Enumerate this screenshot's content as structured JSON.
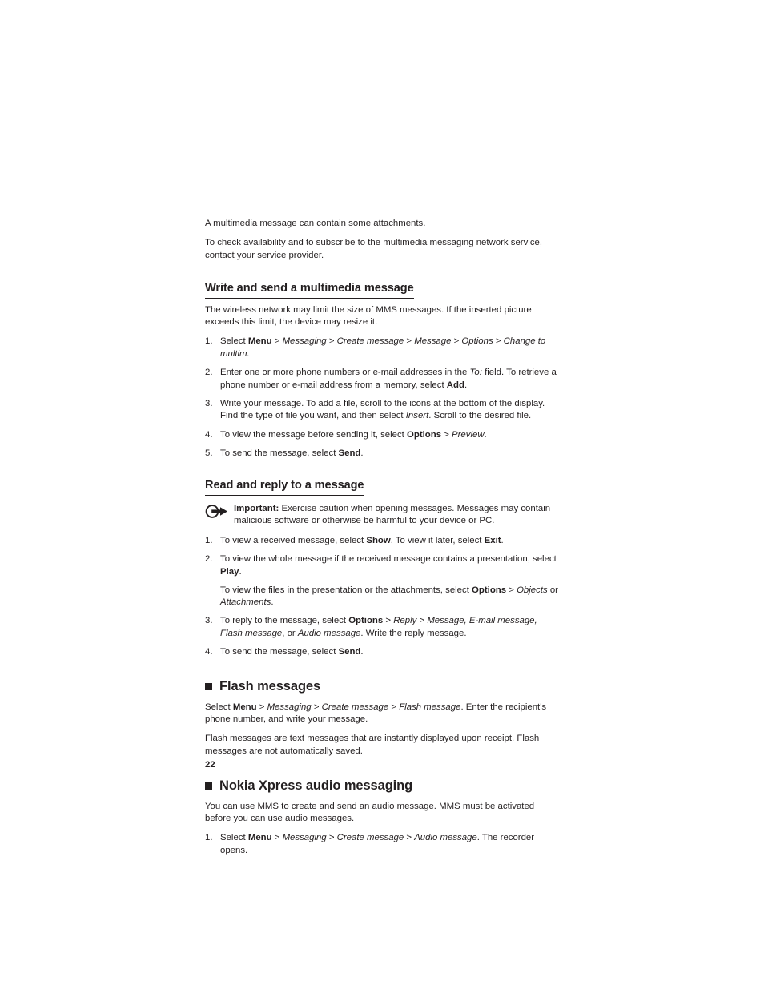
{
  "document": {
    "page_number": "22",
    "text_color": "#231f20",
    "background_color": "#ffffff"
  },
  "intro": {
    "para1": "A multimedia message can contain some attachments.",
    "para2": "To check availability and to subscribe to the multimedia messaging network service, contact your service provider."
  },
  "section_write_send": {
    "heading": "Write and send a multimedia message",
    "intro": "The wireless network may limit the size of MMS messages. If the inserted picture exceeds this limit, the device may resize it.",
    "steps": [
      {
        "num": "1.",
        "parts": [
          {
            "text": "Select ",
            "style": "normal"
          },
          {
            "text": "Menu",
            "style": "bold"
          },
          {
            "text": " > ",
            "style": "normal"
          },
          {
            "text": "Messaging",
            "style": "italic"
          },
          {
            "text": " > ",
            "style": "normal"
          },
          {
            "text": "Create message",
            "style": "italic"
          },
          {
            "text": " > ",
            "style": "normal"
          },
          {
            "text": "Message",
            "style": "italic"
          },
          {
            "text": " > ",
            "style": "normal"
          },
          {
            "text": "Options",
            "style": "italic"
          },
          {
            "text": " > ",
            "style": "normal"
          },
          {
            "text": "Change to multim.",
            "style": "italic"
          }
        ]
      },
      {
        "num": "2.",
        "parts": [
          {
            "text": "Enter one or more phone numbers or e-mail addresses in the ",
            "style": "normal"
          },
          {
            "text": "To:",
            "style": "italic"
          },
          {
            "text": " field. To retrieve a phone number or e-mail address from a memory, select ",
            "style": "normal"
          },
          {
            "text": "Add",
            "style": "bold"
          },
          {
            "text": ".",
            "style": "normal"
          }
        ]
      },
      {
        "num": "3.",
        "parts": [
          {
            "text": "Write your message. To add a file, scroll to the icons at the bottom of the display.",
            "style": "normal"
          },
          {
            "text": "BREAK",
            "style": "break"
          },
          {
            "text": "Find the type of file you want, and then select ",
            "style": "normal"
          },
          {
            "text": "Insert",
            "style": "italic"
          },
          {
            "text": ". Scroll to the desired file.",
            "style": "normal"
          }
        ]
      },
      {
        "num": "4.",
        "parts": [
          {
            "text": "To view the message before sending it, select ",
            "style": "normal"
          },
          {
            "text": "Options",
            "style": "bold"
          },
          {
            "text": " > ",
            "style": "normal"
          },
          {
            "text": "Preview",
            "style": "italic"
          },
          {
            "text": ".",
            "style": "normal"
          }
        ]
      },
      {
        "num": "5.",
        "parts": [
          {
            "text": "To send the message, select ",
            "style": "normal"
          },
          {
            "text": "Send",
            "style": "bold"
          },
          {
            "text": ".",
            "style": "normal"
          }
        ]
      }
    ]
  },
  "section_read_reply": {
    "heading": "Read and reply to a message",
    "important": {
      "icon": "important-pointer-icon",
      "label": "Important:",
      "text": " Exercise caution when opening messages. Messages may contain malicious software or otherwise be harmful to your device or PC."
    },
    "steps": [
      {
        "num": "1.",
        "parts": [
          {
            "text": "To view a received message, select ",
            "style": "normal"
          },
          {
            "text": "Show",
            "style": "bold"
          },
          {
            "text": ". To view it later, select ",
            "style": "normal"
          },
          {
            "text": "Exit",
            "style": "bold"
          },
          {
            "text": ".",
            "style": "normal"
          }
        ]
      },
      {
        "num": "2.",
        "parts": [
          {
            "text": "To view the whole message if the received message contains a presentation, select ",
            "style": "normal"
          },
          {
            "text": "Play",
            "style": "bold"
          },
          {
            "text": ".",
            "style": "normal"
          },
          {
            "text": "PARA",
            "style": "para"
          },
          {
            "text": "To view the files in the presentation or the attachments, select ",
            "style": "normal"
          },
          {
            "text": "Options",
            "style": "bold"
          },
          {
            "text": " > ",
            "style": "normal"
          },
          {
            "text": "Objects",
            "style": "italic"
          },
          {
            "text": " or ",
            "style": "normal"
          },
          {
            "text": "Attachments",
            "style": "italic"
          },
          {
            "text": ".",
            "style": "normal"
          }
        ]
      },
      {
        "num": "3.",
        "parts": [
          {
            "text": "To reply to the message, select ",
            "style": "normal"
          },
          {
            "text": "Options",
            "style": "bold"
          },
          {
            "text": " > ",
            "style": "normal"
          },
          {
            "text": "Reply",
            "style": "italic"
          },
          {
            "text": " > ",
            "style": "normal"
          },
          {
            "text": "Message, E-mail message, Flash message",
            "style": "italic"
          },
          {
            "text": ", or ",
            "style": "normal"
          },
          {
            "text": "Audio message",
            "style": "italic"
          },
          {
            "text": ". Write the reply message.",
            "style": "normal"
          }
        ]
      },
      {
        "num": "4.",
        "parts": [
          {
            "text": "To send the message, select ",
            "style": "normal"
          },
          {
            "text": "Send",
            "style": "bold"
          },
          {
            "text": ".",
            "style": "normal"
          }
        ]
      }
    ]
  },
  "section_flash": {
    "bullet": "square-bullet-icon",
    "heading": "Flash messages",
    "para1_parts": [
      {
        "text": "Select ",
        "style": "normal"
      },
      {
        "text": "Menu",
        "style": "bold"
      },
      {
        "text": " > ",
        "style": "normal"
      },
      {
        "text": "Messaging",
        "style": "italic"
      },
      {
        "text": " > ",
        "style": "normal"
      },
      {
        "text": "Create message",
        "style": "italic"
      },
      {
        "text": " > ",
        "style": "normal"
      },
      {
        "text": "Flash message",
        "style": "italic"
      },
      {
        "text": ". Enter the recipient's phone number, and write your message.",
        "style": "normal"
      }
    ],
    "para2": "Flash messages are text messages that are instantly displayed upon receipt. Flash messages are not automatically saved."
  },
  "section_xpress": {
    "bullet": "square-bullet-icon",
    "heading": "Nokia Xpress audio messaging",
    "para1": "You can use MMS to create and send an audio message. MMS must be activated before you can use audio messages.",
    "steps": [
      {
        "num": "1.",
        "parts": [
          {
            "text": "Select ",
            "style": "normal"
          },
          {
            "text": "Menu",
            "style": "bold"
          },
          {
            "text": " > ",
            "style": "normal"
          },
          {
            "text": "Messaging",
            "style": "italic"
          },
          {
            "text": " > ",
            "style": "normal"
          },
          {
            "text": "Create message",
            "style": "italic"
          },
          {
            "text": " > ",
            "style": "normal"
          },
          {
            "text": "Audio message",
            "style": "italic"
          },
          {
            "text": ". The recorder opens.",
            "style": "normal"
          }
        ]
      }
    ]
  }
}
